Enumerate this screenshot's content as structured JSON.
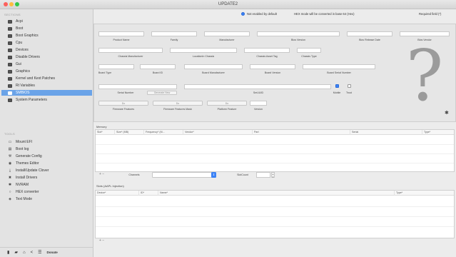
{
  "window": {
    "title": "UPDATE2"
  },
  "sidebar": {
    "sections_header": "SECTIONS",
    "sections": [
      {
        "label": "Acpi",
        "icon": "box-icon"
      },
      {
        "label": "Boot",
        "icon": "box-icon"
      },
      {
        "label": "Boot Graphics",
        "icon": "box-icon"
      },
      {
        "label": "Cpu",
        "icon": "box-icon"
      },
      {
        "label": "Devices",
        "icon": "box-icon"
      },
      {
        "label": "Disable Drivers",
        "icon": "box-icon"
      },
      {
        "label": "Gui",
        "icon": "box-icon"
      },
      {
        "label": "Graphics",
        "icon": "box-icon"
      },
      {
        "label": "Kernel and Kext Patches",
        "icon": "box-icon"
      },
      {
        "label": "Rt Variables",
        "icon": "box-icon"
      },
      {
        "label": "SMBIOS",
        "icon": "box-icon",
        "selected": true
      },
      {
        "label": "System Parameters",
        "icon": "box-icon"
      }
    ],
    "tools_header": "TOOLS",
    "tools": [
      {
        "label": "Mount EFI",
        "icon": "drive-icon",
        "glyph": "▭"
      },
      {
        "label": "Boot log",
        "icon": "log-icon",
        "glyph": "▤"
      },
      {
        "label": "Generate Config",
        "icon": "wrench-icon",
        "glyph": "⚒"
      },
      {
        "label": "Themes Editor",
        "icon": "eye-icon",
        "glyph": "◉"
      },
      {
        "label": "Install/Update Clover",
        "icon": "download-icon",
        "glyph": "⤓"
      },
      {
        "label": "Install Drivers",
        "icon": "tools-icon",
        "glyph": "✖"
      },
      {
        "label": "NVRAM",
        "icon": "gear-icon",
        "glyph": "✱"
      },
      {
        "label": "HEX converter",
        "icon": "circle-icon",
        "glyph": "○"
      },
      {
        "label": "Text Mode",
        "icon": "eye-icon",
        "glyph": "◈"
      }
    ],
    "bottom": {
      "donate": "Donate"
    }
  },
  "options": {
    "not_enabled": "Not enabled by default",
    "hex_note": "HEX mode will be converted in base 64 (Hex)",
    "required": "Required field (*)"
  },
  "smbios": {
    "labels": {
      "product_name": "Product Name",
      "family": "Family",
      "manufacturer": "Manufacturer",
      "bios_version": "Bios Version",
      "bios_release_date": "Bios Release Date",
      "bios_vendor": "Bios Vendor",
      "chassis_manufacturer": "Chassis Manufacturer",
      "location_in_chassis": "LocationIn Chassis",
      "chassis_asset_tag": "Chassis Asset Tag",
      "chassis_type": "Chassis Type",
      "board_type": "Board Type",
      "board_id": "Board ID",
      "board_manufacturer": "Board Manufacturer",
      "board_version": "Board Version",
      "board_serial_number": "Board Serial Number",
      "serial_number": "Serial Number",
      "smuuid": "SmUUID",
      "mobile": "Mobile",
      "trust": "Trust",
      "firmware_features": "Firmware Features",
      "firmware_features_mask": "Firmware Features Mask",
      "platform_feature": "Platform Feature",
      "version": "Version"
    },
    "buttons": {
      "generate_new": "Generate New",
      "fw_features": "Do",
      "fw_mask": "Do",
      "platform": "Do"
    }
  },
  "memory": {
    "title": "Memory",
    "columns": [
      "Slot*",
      "Size* (MB)",
      "Frequency* (M...",
      "Vendor*",
      "Part",
      "Serial",
      "Type*"
    ],
    "channels_label": "Channels",
    "slotcount_label": "SlotCount"
  },
  "slots": {
    "title": "Slots (AAPL Injection)",
    "columns": [
      "Device*",
      "ID*",
      "Name*",
      "Type*"
    ]
  }
}
